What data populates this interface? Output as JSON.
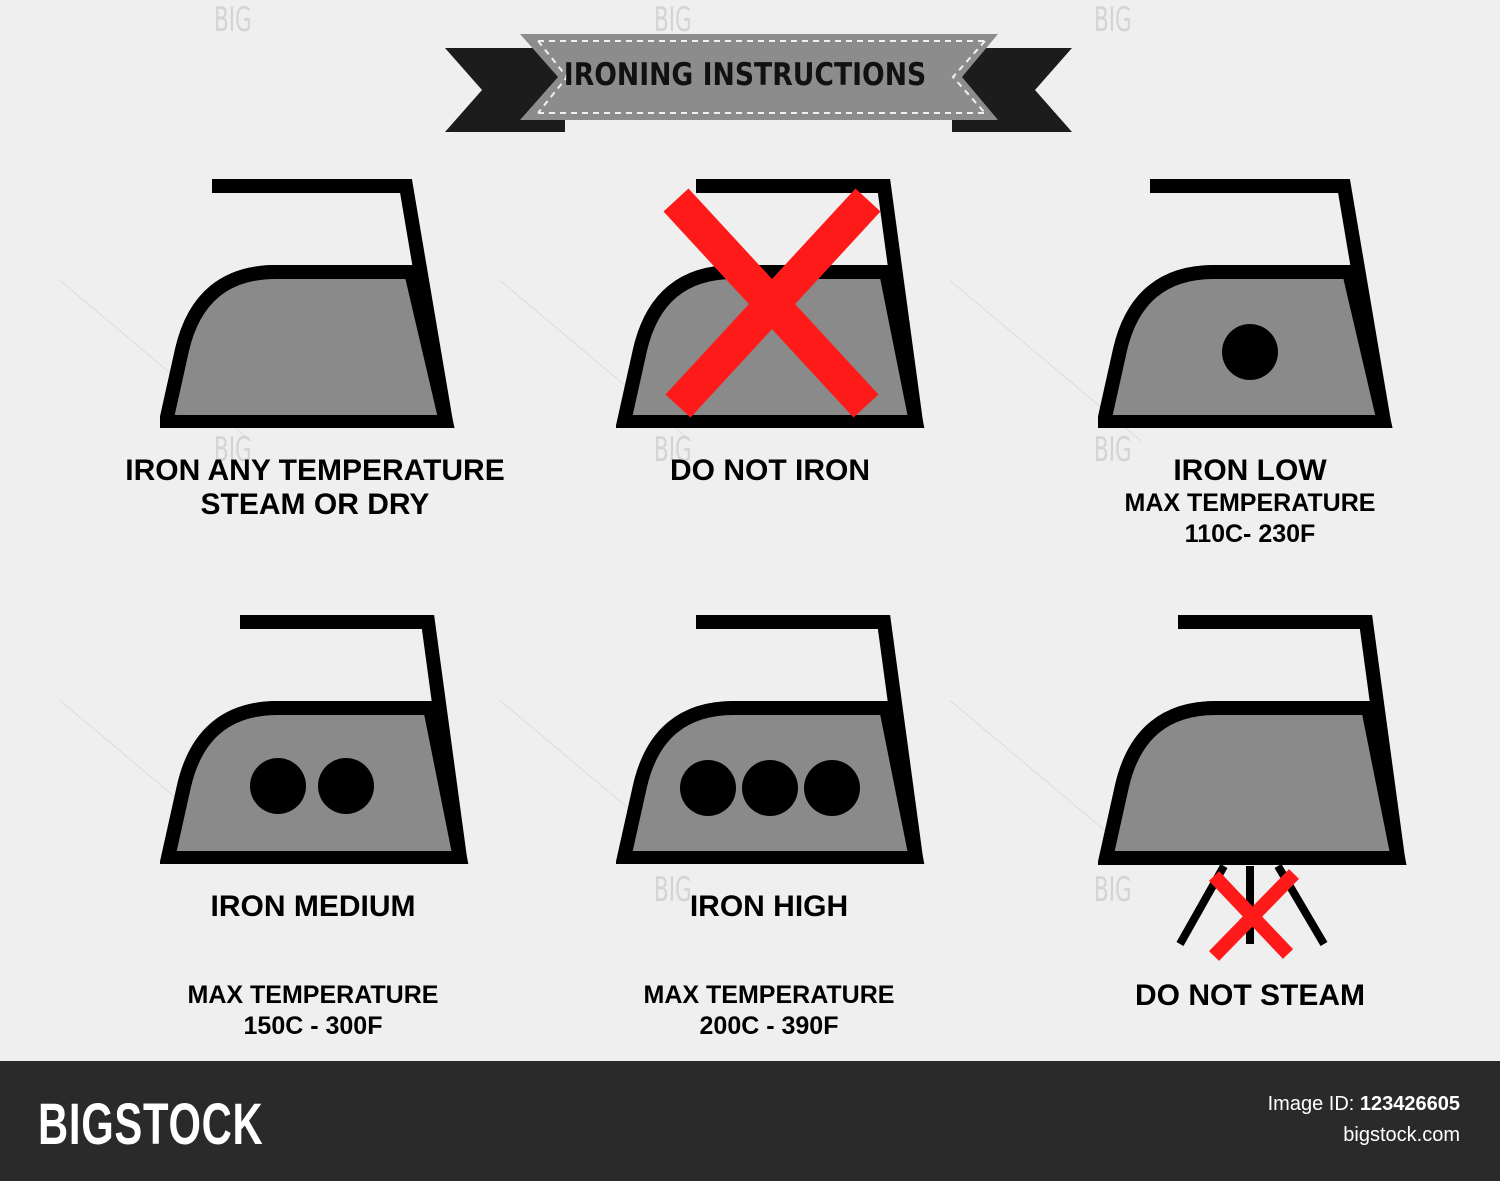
{
  "title": "IRONING INSTRUCTIONS",
  "colors": {
    "background": "#efefef",
    "iron_fill": "#8a8a8a",
    "outline": "#000000",
    "cross": "#ff1a1a",
    "banner_fill": "#8c8c8c",
    "banner_dark": "#1c1c1c",
    "footer": "#2a2a2a"
  },
  "symbols": [
    {
      "name": "iron-any-temperature",
      "dots": 0,
      "cross": false,
      "no_steam": false,
      "label_main": "IRON ANY  TEMPERATURE",
      "label_line2": "STEAM  OR DRY",
      "label_line3": ""
    },
    {
      "name": "do-not-iron",
      "dots": 0,
      "cross": true,
      "no_steam": false,
      "label_main": "DO NOT IRON",
      "label_line2": "",
      "label_line3": ""
    },
    {
      "name": "iron-low",
      "dots": 1,
      "cross": false,
      "no_steam": false,
      "label_main": "IRON LOW",
      "label_line2": "MAX TEMPERATURE",
      "label_line3": "110C- 230F"
    },
    {
      "name": "iron-medium",
      "dots": 2,
      "cross": false,
      "no_steam": false,
      "label_main": "IRON MEDIUM",
      "label_line2": "MAX TEMPERATURE",
      "label_line3": "150C - 300F"
    },
    {
      "name": "iron-high",
      "dots": 3,
      "cross": false,
      "no_steam": false,
      "label_main": "IRON HIGH",
      "label_line2": "MAX TEMPERATURE",
      "label_line3": "200C - 390F"
    },
    {
      "name": "do-not-steam",
      "dots": 0,
      "cross": false,
      "no_steam": true,
      "label_main": "DO NOT STEAM",
      "label_line2": "",
      "label_line3": ""
    }
  ],
  "watermark": {
    "big": "BIG",
    "brand": "BIGSTOCK"
  },
  "footer": {
    "brand": "BIGSTOCK",
    "image_id_label": "Image ID:",
    "image_id": "123426605",
    "site": "bigstock.com"
  }
}
